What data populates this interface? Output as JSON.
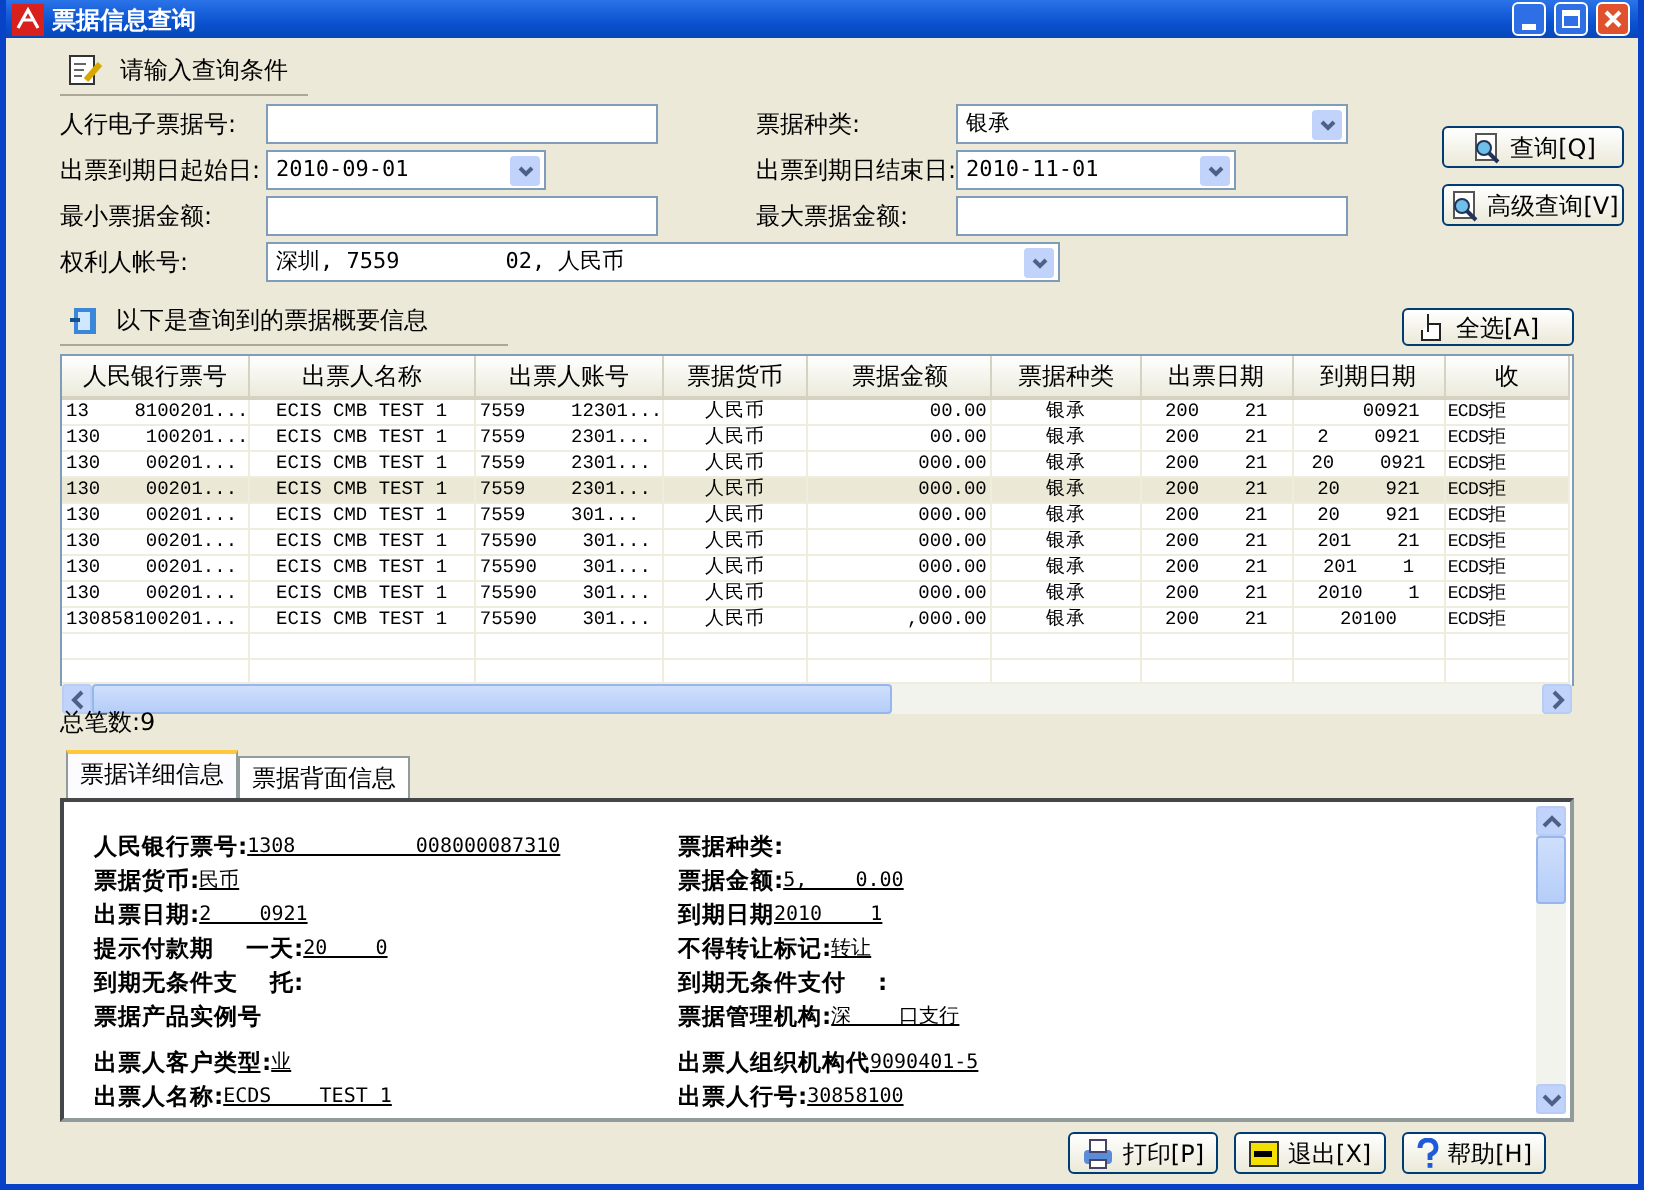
{
  "window": {
    "title": "票据信息查询"
  },
  "query_section": {
    "title": "请输入查询条件"
  },
  "filter_rows": [
    [
      {
        "kind": "text",
        "label": "人行电子票据号:"
      },
      {
        "kind": "select",
        "label": "票据种类:",
        "value": "银承"
      }
    ],
    [
      {
        "kind": "date",
        "label": "出票到期日起始日:",
        "value": "2010-09-01"
      },
      {
        "kind": "date",
        "label": "出票到期日结束日:",
        "value": "2010-11-01"
      }
    ],
    [
      {
        "kind": "text",
        "label": "最小票据金额:"
      },
      {
        "kind": "text",
        "label": "最大票据金额:"
      }
    ],
    [
      {
        "kind": "wide-select",
        "label": "权利人帐号:",
        "value": "深圳, 7559        02, 人民币"
      }
    ]
  ],
  "query_buttons": [
    {
      "kind": "search",
      "label": "查询[Q]"
    },
    {
      "kind": "search",
      "label": "高级查询[V]"
    }
  ],
  "results_section": {
    "title": "以下是查询到的票据概要信息",
    "select_all": "全选[A]"
  },
  "table": {
    "columns": [
      "人民银行票号",
      "出票人名称",
      "出票人账号",
      "票据货币",
      "票据金额",
      "票据种类",
      "出票日期",
      "到期日期",
      "收"
    ],
    "rows": [
      {
        "selected": false,
        "cells": [
          "13    8100201...",
          "ECIS CMB TEST 1",
          "7559    12301...",
          "人民币",
          "    00.00",
          "银承",
          "200    21",
          "    00921",
          "ECDS拒"
        ]
      },
      {
        "selected": false,
        "cells": [
          "130    100201...",
          "ECIS CMB TEST 1",
          "7559    2301...",
          "人民币",
          "    00.00",
          "银承",
          "200    21",
          "2    0921",
          "ECDS拒"
        ]
      },
      {
        "selected": false,
        "cells": [
          "130    00201...",
          "ECIS CMB TEST 1",
          "7559    2301...",
          "人民币",
          "    000.00",
          "银承",
          "200    21",
          "20    0921",
          "ECDS拒"
        ]
      },
      {
        "selected": true,
        "cells": [
          "130    00201...",
          "ECIS CMB TEST 1",
          "7559    2301...",
          "人民币",
          "    000.00",
          "银承",
          "200    21",
          "20    921",
          "ECDS拒"
        ]
      },
      {
        "selected": false,
        "cells": [
          "130    00201...",
          "ECIS CMD TEST 1",
          "7559    301...",
          "人民币",
          "    000.00",
          "银承",
          "200    21",
          "20    921",
          "ECDS拒"
        ]
      },
      {
        "selected": false,
        "cells": [
          "130    00201...",
          "ECIS CMB TEST 1",
          "75590    301...",
          "人民币",
          "    000.00",
          "银承",
          "200    21",
          "201    21",
          "ECDS拒"
        ]
      },
      {
        "selected": false,
        "cells": [
          "130    00201...",
          "ECIS CMB TEST 1",
          "75590    301...",
          "人民币",
          "    000.00",
          "银承",
          "200    21",
          "201    1",
          "ECDS拒"
        ]
      },
      {
        "selected": false,
        "cells": [
          "130    00201...",
          "ECIS CMB TEST 1",
          "75590    301...",
          "人民币",
          "    000.00",
          "银承",
          "200    21",
          "2010    1",
          "ECDS拒"
        ]
      },
      {
        "selected": false,
        "cells": [
          "130858100201...",
          "ECIS CMB TEST 1",
          "75590    301...",
          "人民币",
          "    ,000.00",
          "银承",
          "200    21",
          "20100",
          "ECDS拒"
        ]
      }
    ]
  },
  "total": "总笔数:9",
  "tabs": [
    {
      "label": "票据详细信息",
      "selected": true
    },
    {
      "label": "票据背面信息",
      "selected": false
    }
  ],
  "detail_groups": [
    [
      [
        {
          "label": "人民银行票号:",
          "value": "1308          008000087310"
        },
        {
          "label": "票据种类:"
        }
      ],
      [
        {
          "label": "票据货币:",
          "value": "民币"
        },
        {
          "label": "票据金额:",
          "value": "5,    0.00"
        }
      ],
      [
        {
          "label": "出票日期:",
          "value": "2    0921"
        },
        {
          "label": "到期日期",
          "value": "2010    1"
        }
      ],
      [
        {
          "label": "提示付款期    一天:",
          "value": "20    0"
        },
        {
          "label": "不得转让标记:",
          "value": "转让"
        }
      ],
      [
        {
          "label": "到期无条件支    托:"
        },
        {
          "label": "到期无条件支付    :"
        }
      ],
      [
        {
          "label": "票据产品实例号"
        },
        {
          "label": "票据管理机构:",
          "value": "深    口支行"
        }
      ]
    ],
    [
      [
        {
          "label": "出票人客户类型:",
          "value": "业"
        },
        {
          "label": "出票人组织机构代",
          "value": "9090401-5"
        }
      ],
      [
        {
          "label": "出票人名称:",
          "value": "ECDS    TEST 1"
        },
        {
          "label": "出票人行号:",
          "value": "30858100"
        }
      ]
    ]
  ],
  "footer_buttons": [
    {
      "kind": "print",
      "label": "打印[P]"
    },
    {
      "kind": "exit",
      "label": "退出[X]"
    },
    {
      "kind": "help",
      "label": "帮助[H]"
    }
  ]
}
